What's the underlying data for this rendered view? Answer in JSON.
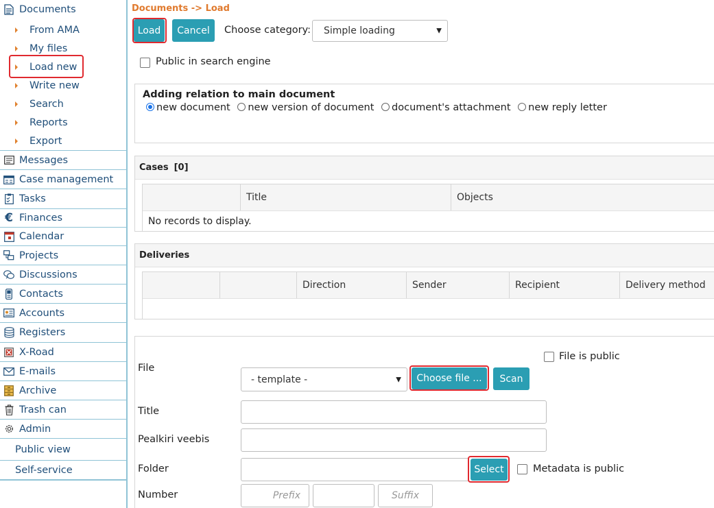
{
  "sidebar": {
    "documents": "Documents",
    "sub_items": [
      "From AMA",
      "My files",
      "Load new",
      "Write new",
      "Search",
      "Reports",
      "Export"
    ],
    "items": [
      "Messages",
      "Case management",
      "Tasks",
      "Finances",
      "Calendar",
      "Projects",
      "Discussions",
      "Contacts",
      "Accounts",
      "Registers",
      "X-Road",
      "E-mails",
      "Archive",
      "Trash can",
      "Admin"
    ],
    "public_view": "Public view",
    "self_service": "Self-service"
  },
  "breadcrumb": "Documents -> Load",
  "toolbar": {
    "load": "Load",
    "cancel": "Cancel",
    "choose_category": "Choose category:",
    "category_value": "Simple loading"
  },
  "public_in_search": "Public in search engine",
  "relation": {
    "title": "Adding relation to main document",
    "options": [
      "new document",
      "new version of document",
      "document's attachment",
      "new reply letter"
    ]
  },
  "cases": {
    "title": "Cases",
    "count": "[0]",
    "columns": [
      "Title",
      "Objects"
    ],
    "empty": "No records to display."
  },
  "deliveries": {
    "title": "Deliveries",
    "columns": [
      "Direction",
      "Sender",
      "Recipient",
      "Delivery method"
    ]
  },
  "form": {
    "file_label": "File",
    "file_is_public": "File is public",
    "template_value": "- template -",
    "choose_file": "Choose file ...",
    "scan": "Scan",
    "title_label": "Title",
    "pealkiri_label": "Pealkiri veebis",
    "folder_label": "Folder",
    "select": "Select",
    "metadata_public": "Metadata is public",
    "number_label": "Number",
    "prefix_placeholder": "Prefix",
    "suffix_placeholder": "Suffix"
  }
}
